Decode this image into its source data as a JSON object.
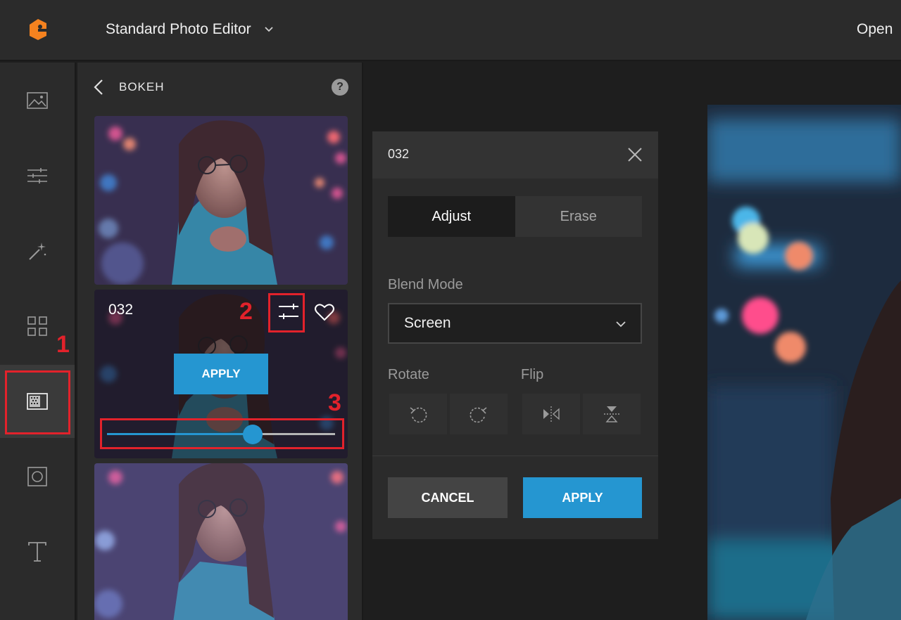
{
  "topbar": {
    "app_title": "Standard Photo Editor",
    "open_label": "Open"
  },
  "rail": {
    "items": [
      {
        "icon": "image-icon"
      },
      {
        "icon": "sliders-icon"
      },
      {
        "icon": "magic-wand-icon"
      },
      {
        "icon": "grid-icon"
      },
      {
        "icon": "overlay-icon",
        "active": true
      },
      {
        "icon": "frame-icon"
      },
      {
        "icon": "text-icon"
      }
    ]
  },
  "annotations": {
    "one": "1",
    "two": "2",
    "three": "3",
    "color": "#e2222b"
  },
  "panel": {
    "title": "BOKEH",
    "help": "?",
    "selected_thumb": {
      "label": "032",
      "apply_label": "APPLY",
      "intensity": 0.64
    }
  },
  "dialog": {
    "title": "032",
    "tabs": [
      "Adjust",
      "Erase"
    ],
    "active_tab": "Adjust",
    "blend_mode_label": "Blend Mode",
    "blend_mode_value": "Screen",
    "rotate_label": "Rotate",
    "flip_label": "Flip",
    "cancel_label": "CANCEL",
    "apply_label": "APPLY"
  },
  "colors": {
    "accent": "#2596d1",
    "logo": "#f5821f"
  }
}
